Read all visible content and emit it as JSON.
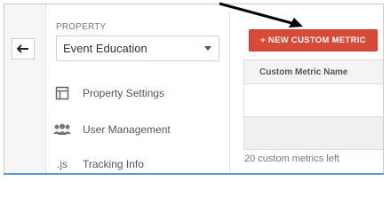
{
  "property": {
    "label": "PROPERTY",
    "selected": "Event Education"
  },
  "nav": [
    {
      "label": "Property Settings",
      "icon": "property-settings-icon"
    },
    {
      "label": "User Management",
      "icon": "users-icon"
    },
    {
      "label": "Tracking Info",
      "icon": "js-icon"
    }
  ],
  "icons": {
    "js_text": ".js"
  },
  "main": {
    "new_button_label": "+ NEW CUSTOM METRIC",
    "table_header": "Custom Metric Name",
    "metrics_left": "20 custom metrics left"
  },
  "colors": {
    "accent_red": "#d84a38"
  }
}
